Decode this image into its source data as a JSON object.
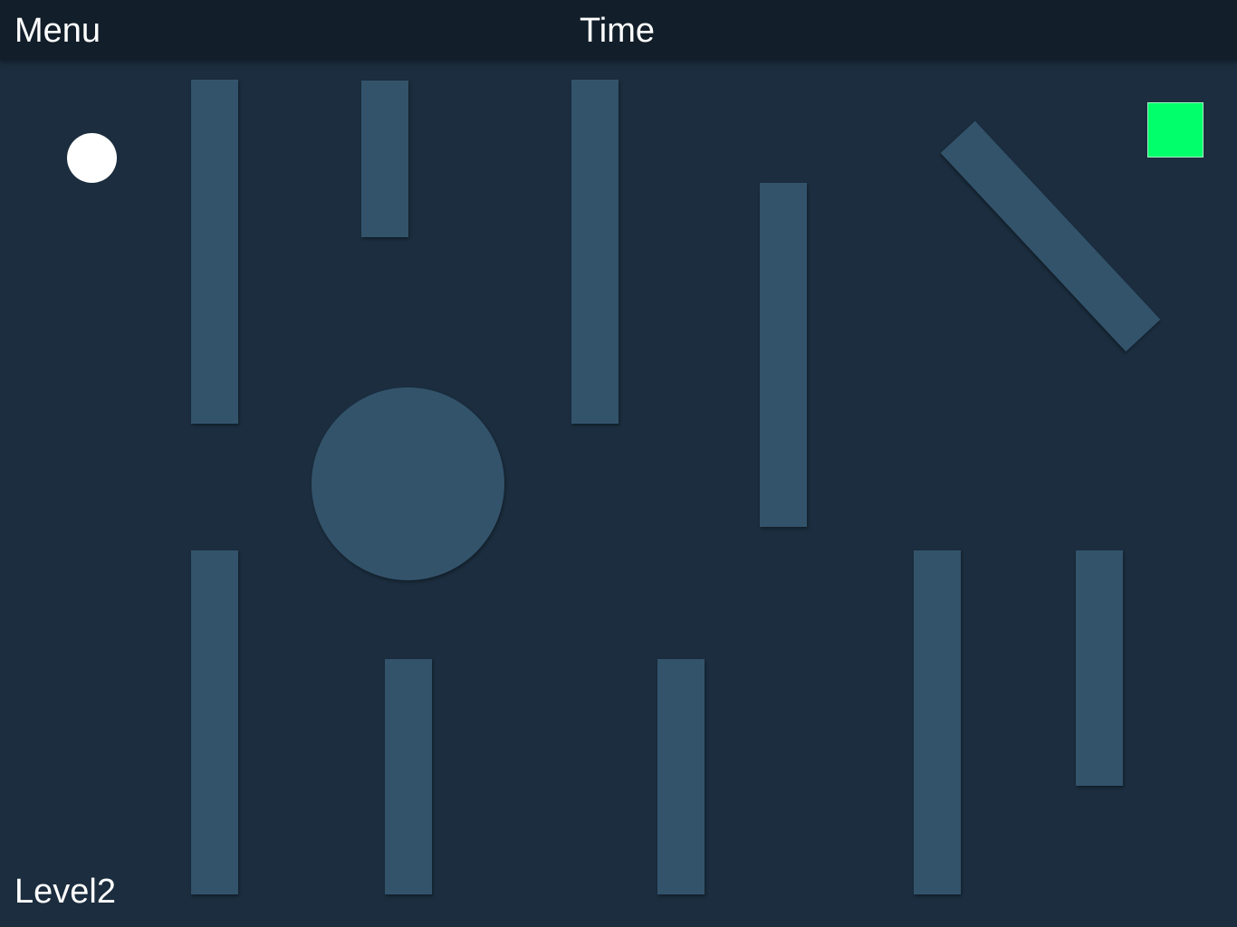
{
  "header": {
    "menu_label": "Menu",
    "time_label": "Time"
  },
  "footer": {
    "level_label": "Level2"
  },
  "colors": {
    "background": "#1b2d3e",
    "topbar": "#121e29",
    "obstacle": "#33536b",
    "ball": "#ffffff",
    "goal": "#00ff6a"
  }
}
